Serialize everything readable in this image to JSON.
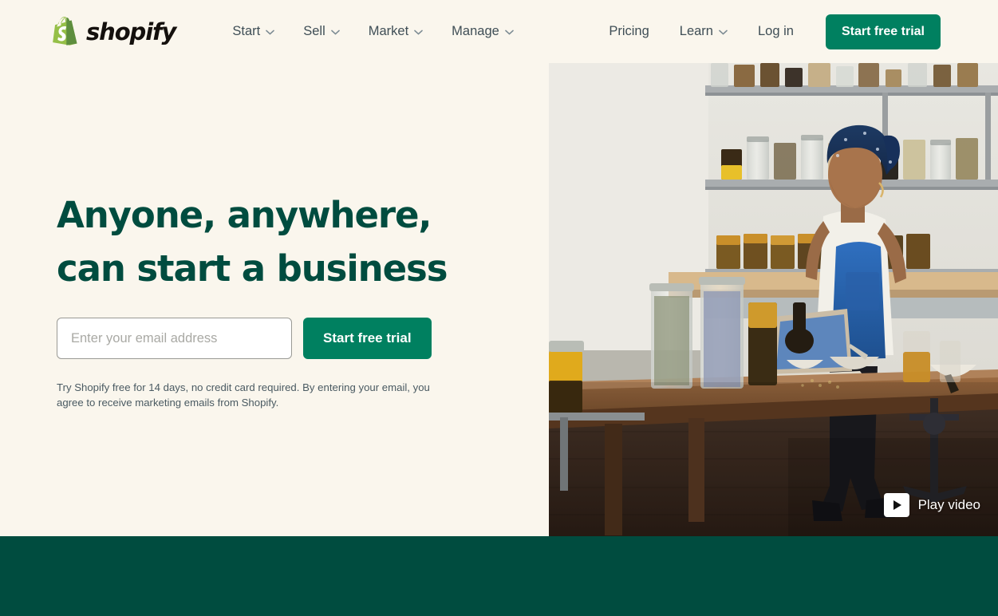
{
  "brand": {
    "name": "shopify",
    "logo_icon": "shopify-bag-logo",
    "logo_color": "#95bf47",
    "wordmark_color": "#14100d"
  },
  "colors": {
    "page_background": "#faf6ed",
    "brand_green_dark": "#004c3f",
    "brand_green": "#008060",
    "nav_text": "#3f4e56",
    "band_green": "#004c3f"
  },
  "nav": {
    "main_items": [
      {
        "label": "Start",
        "has_dropdown": true,
        "icon": "chevron-down-icon"
      },
      {
        "label": "Sell",
        "has_dropdown": true,
        "icon": "chevron-down-icon"
      },
      {
        "label": "Market",
        "has_dropdown": true,
        "icon": "chevron-down-icon"
      },
      {
        "label": "Manage",
        "has_dropdown": true,
        "icon": "chevron-down-icon"
      }
    ],
    "right_items": [
      {
        "label": "Pricing",
        "has_dropdown": false
      },
      {
        "label": "Learn",
        "has_dropdown": true,
        "icon": "chevron-down-icon"
      },
      {
        "label": "Log in",
        "has_dropdown": false
      }
    ],
    "cta_label": "Start free trial"
  },
  "hero": {
    "title_line1": "Anyone, anywhere,",
    "title_line2": "can start a business",
    "email_placeholder": "Enter your email address",
    "email_value": "",
    "cta_label": "Start free trial",
    "legal": "Try Shopify free for 14 days, no credit card required. By entering your email, you agree to receive marketing emails from Shopify.",
    "media": {
      "alt": "Shop owner in blue headwrap and apron working on a laptop at a wooden table with jars of goods on shelves behind her",
      "play_label": "Play video",
      "play_icon": "play-triangle-icon"
    }
  }
}
